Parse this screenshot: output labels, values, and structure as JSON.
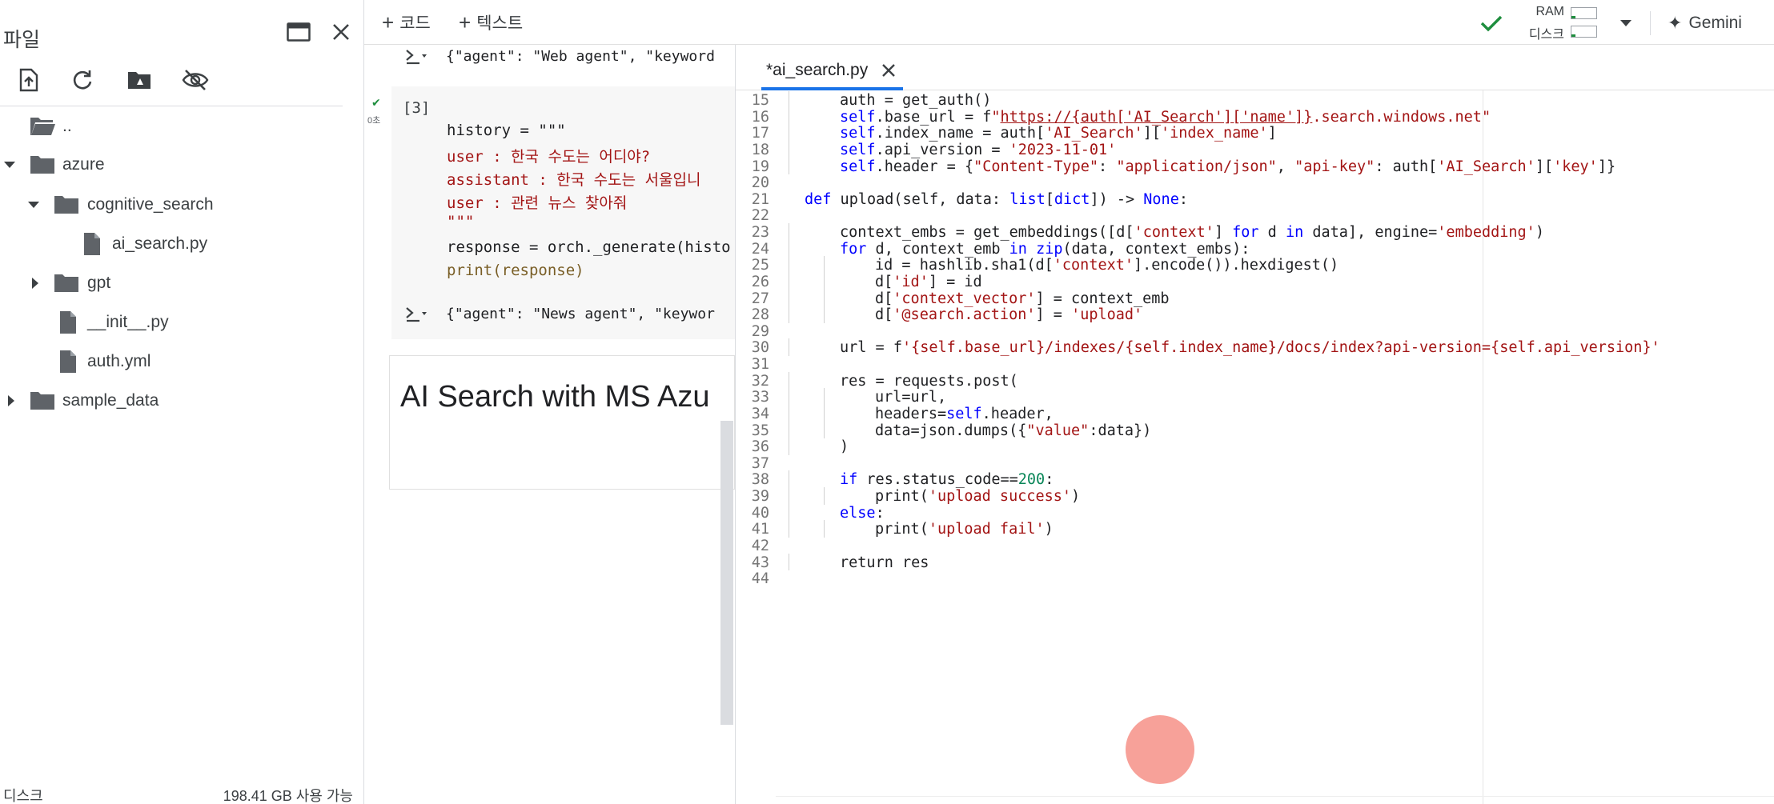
{
  "file_panel": {
    "title": "파일",
    "tree": [
      {
        "label": "..",
        "type": "parent-folder"
      },
      {
        "label": "azure",
        "type": "folder",
        "expanded": true
      },
      {
        "label": "cognitive_search",
        "type": "folder",
        "expanded": true
      },
      {
        "label": "ai_search.py",
        "type": "file"
      },
      {
        "label": "gpt",
        "type": "folder",
        "expanded": false
      },
      {
        "label": "__init__.py",
        "type": "file"
      },
      {
        "label": "auth.yml",
        "type": "file"
      },
      {
        "label": "sample_data",
        "type": "folder",
        "expanded": false
      }
    ],
    "disk_label": "디스크",
    "disk_free": "198.41 GB 사용 가능"
  },
  "toolbar": {
    "add_code": "코드",
    "add_text": "텍스트",
    "ram_label": "RAM",
    "disk_label": "디스크",
    "ram_fraction": 0.15,
    "disk_fraction": 0.15,
    "gemini": "Gemini"
  },
  "notebook": {
    "prev_output": "{\"agent\": \"Web agent\", \"keyword",
    "exec_count": "[3]",
    "exec_time": "0초",
    "code_lines": [
      {
        "text": "history = \"\"\"",
        "cls": ""
      },
      {
        "text": "user : 한국 수도는 어디야?",
        "cls": "k-str"
      },
      {
        "text": "assistant : 한국 수도는 서울입니",
        "cls": "k-str"
      },
      {
        "text": "user : 관련 뉴스 찾아줘",
        "cls": "k-str"
      },
      {
        "text": "\"\"\"",
        "cls": "k-str"
      },
      {
        "text": "response = orch._generate(histo",
        "cls": ""
      },
      {
        "text": "print(response)",
        "cls": "k-fn"
      }
    ],
    "output": "{\"agent\": \"News agent\", \"keywor",
    "text_cell_heading": "AI Search with MS Azu"
  },
  "editor": {
    "tab_title": "*ai_search.py",
    "lines": [
      {
        "n": "15",
        "indent": 2,
        "html": "auth = get_auth()"
      },
      {
        "n": "16",
        "indent": 2,
        "html": "<span class=\"ky\">self</span>.base_url = f<span class=\"st\">\"</span><span class=\"un\">https://{auth['AI_Search']['name']}</span><span class=\"st\">.search.windows.net\"</span>"
      },
      {
        "n": "17",
        "indent": 2,
        "html": "<span class=\"ky\">self</span>.index_name = auth[<span class=\"st\">'AI_Search'</span>][<span class=\"st\">'index_name'</span>]"
      },
      {
        "n": "18",
        "indent": 2,
        "html": "<span class=\"ky\">self</span>.api_version = <span class=\"st\">'2023-11-01'</span>"
      },
      {
        "n": "19",
        "indent": 2,
        "html": "<span class=\"ky\">self</span>.header = {<span class=\"st\">\"Content-Type\"</span>: <span class=\"st\">\"application/json\"</span>, <span class=\"st\">\"api-key\"</span>: auth[<span class=\"st\">'AI_Search'</span>][<span class=\"st\">'key'</span>]}"
      },
      {
        "n": "20",
        "indent": 0,
        "html": ""
      },
      {
        "n": "21",
        "indent": 1,
        "html": "<span class=\"kw\">def</span> upload(self, data: <span class=\"kw\">list</span>[<span class=\"kw\">dict</span>]) -&gt; <span class=\"kw\">None</span>:"
      },
      {
        "n": "22",
        "indent": 0,
        "html": ""
      },
      {
        "n": "23",
        "indent": 2,
        "html": "context_embs = get_embeddings([d[<span class=\"st\">'context'</span>] <span class=\"kw\">for</span> d <span class=\"kw\">in</span> data], engine=<span class=\"st\">'embedding'</span>)"
      },
      {
        "n": "24",
        "indent": 2,
        "html": "<span class=\"kw\">for</span> d, context_emb <span class=\"kw\">in</span> <span class=\"kw\">zip</span>(data, context_embs):"
      },
      {
        "n": "25",
        "indent": 3,
        "html": "id = hashlib.sha1(d[<span class=\"st\">'context'</span>].encode()).hexdigest()"
      },
      {
        "n": "26",
        "indent": 3,
        "html": "d[<span class=\"st\">'id'</span>] = id"
      },
      {
        "n": "27",
        "indent": 3,
        "html": "d[<span class=\"st\">'context_vector'</span>] = context_emb"
      },
      {
        "n": "28",
        "indent": 3,
        "html": "d[<span class=\"st\">'@search.action'</span>] = <span class=\"st\">'upload'</span>"
      },
      {
        "n": "29",
        "indent": 0,
        "html": ""
      },
      {
        "n": "30",
        "indent": 2,
        "html": "url = f<span class=\"st\">'{self.base_url}/indexes/{self.index_name}/docs/index?api-version={self.api_version}'</span>"
      },
      {
        "n": "31",
        "indent": 0,
        "html": ""
      },
      {
        "n": "32",
        "indent": 2,
        "html": "res = requests.post("
      },
      {
        "n": "33",
        "indent": 3,
        "html": "url=url,"
      },
      {
        "n": "34",
        "indent": 3,
        "html": "headers=<span class=\"ky\">self</span>.header,"
      },
      {
        "n": "35",
        "indent": 3,
        "html": "data=json.dumps({<span class=\"st\">\"value\"</span>:data})"
      },
      {
        "n": "36",
        "indent": 2,
        "html": ")"
      },
      {
        "n": "37",
        "indent": 0,
        "html": ""
      },
      {
        "n": "38",
        "indent": 2,
        "html": "<span class=\"kw\">if</span> res.status_code==<span class=\"nm\">200</span>:"
      },
      {
        "n": "39",
        "indent": 3,
        "html": "print(<span class=\"st\">'upload success'</span>)"
      },
      {
        "n": "40",
        "indent": 2,
        "html": "<span class=\"kw\">else</span>:"
      },
      {
        "n": "41",
        "indent": 3,
        "html": "print(<span class=\"st\">'upload fail'</span>)"
      },
      {
        "n": "42",
        "indent": 0,
        "html": ""
      },
      {
        "n": "43",
        "indent": 2,
        "html": "return res"
      },
      {
        "n": "44",
        "indent": 0,
        "html": ""
      }
    ]
  },
  "colors": {
    "accent": "#1a73e8",
    "string": "#a31515",
    "keyword": "#0000ff",
    "number": "#098658",
    "success": "#1e8e3e",
    "cursor_highlight": "#f58c82"
  }
}
